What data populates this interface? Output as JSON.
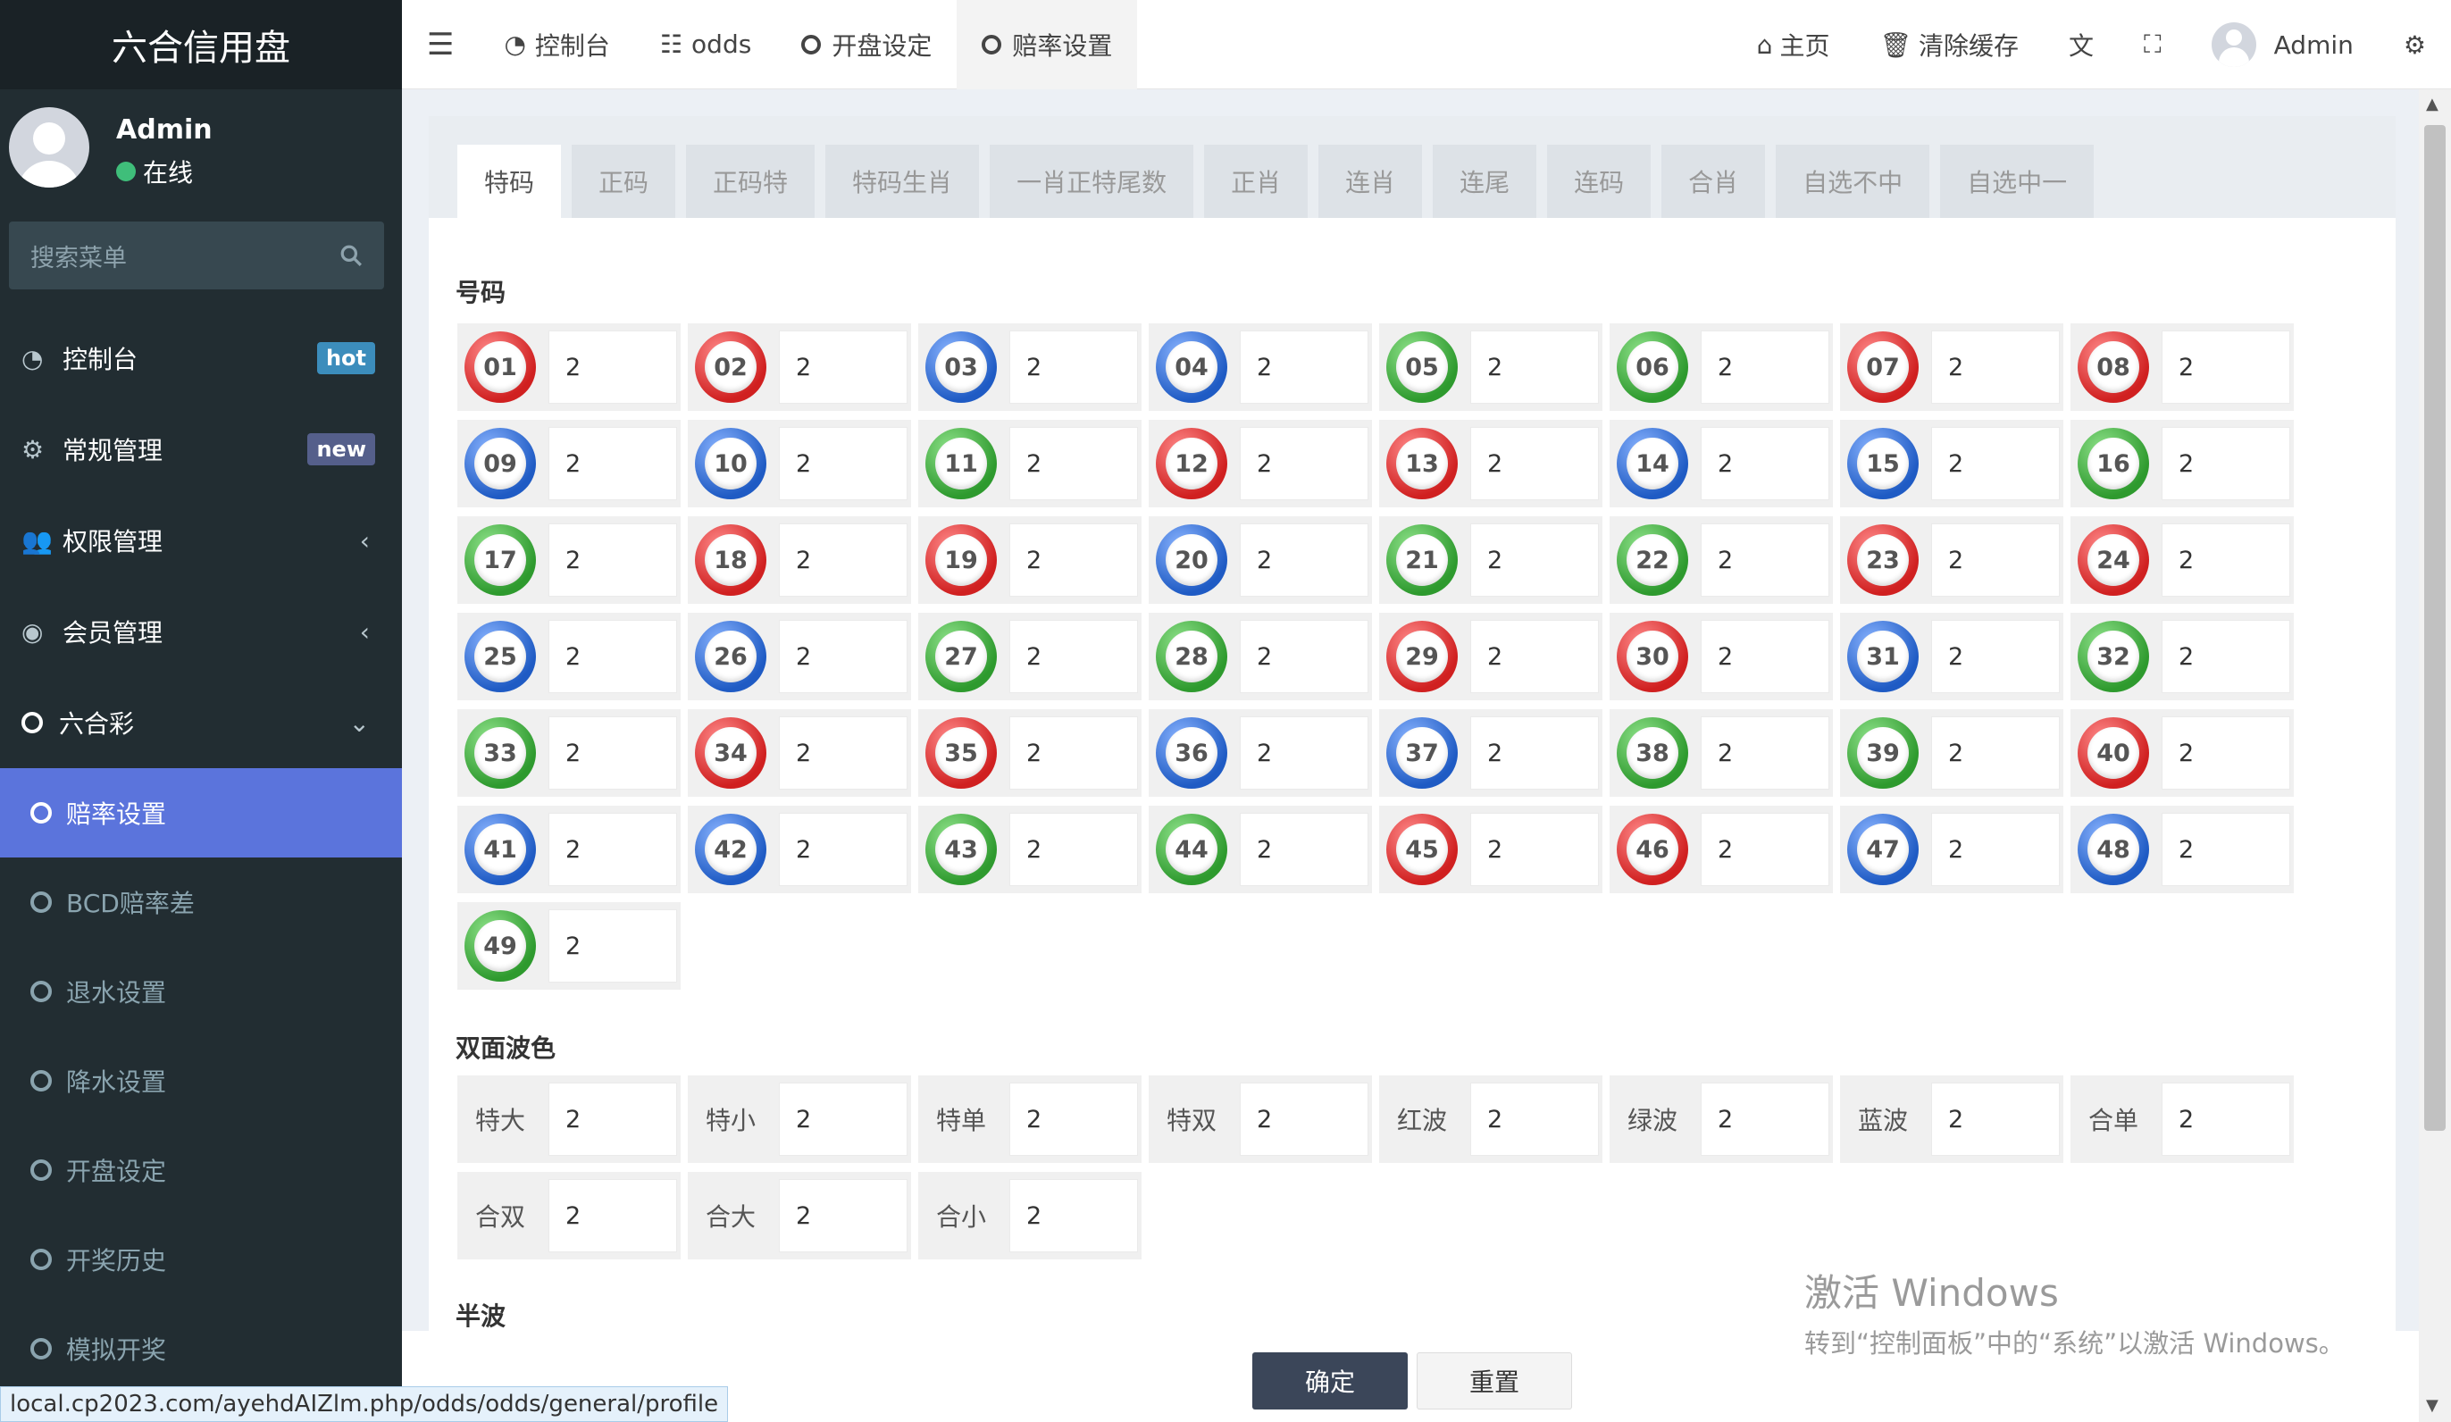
{
  "sidebar": {
    "brand": "六合信用盘",
    "user": {
      "name": "Admin",
      "status": "在线"
    },
    "search_placeholder": "搜索菜单",
    "menu": [
      {
        "icon": "dashboard-icon",
        "label": "控制台",
        "badge": "hot"
      },
      {
        "icon": "gears-icon",
        "label": "常规管理",
        "badge": "new"
      },
      {
        "icon": "users-icon",
        "label": "权限管理"
      },
      {
        "icon": "user-circle-icon",
        "label": "会员管理"
      },
      {
        "icon": "circle-icon",
        "label": "六合彩"
      }
    ],
    "submenu": [
      {
        "label": "赔率设置",
        "active": true
      },
      {
        "label": "BCD赔率差"
      },
      {
        "label": "退水设置"
      },
      {
        "label": "降水设置"
      },
      {
        "label": "开盘设定"
      },
      {
        "label": "开奖历史"
      },
      {
        "label": "模拟开奖"
      }
    ]
  },
  "topbar": {
    "tabs": [
      "控制台",
      "odds",
      "开盘设定",
      "赔率设置"
    ],
    "home": "主页",
    "clear_cache": "清除缓存",
    "admin": "Admin"
  },
  "tabs": [
    "特码",
    "正码",
    "正码特",
    "特码生肖",
    "一肖正特尾数",
    "正肖",
    "连肖",
    "连尾",
    "连码",
    "合肖",
    "自选不中",
    "自选中一"
  ],
  "sections": {
    "numbers_title": "号码",
    "two_sided_title": "双面波色",
    "half_wave_title": "半波"
  },
  "balls": [
    {
      "n": "01",
      "c": "red",
      "v": "2"
    },
    {
      "n": "02",
      "c": "red",
      "v": "2"
    },
    {
      "n": "03",
      "c": "blue",
      "v": "2"
    },
    {
      "n": "04",
      "c": "blue",
      "v": "2"
    },
    {
      "n": "05",
      "c": "green",
      "v": "2"
    },
    {
      "n": "06",
      "c": "green",
      "v": "2"
    },
    {
      "n": "07",
      "c": "red",
      "v": "2"
    },
    {
      "n": "08",
      "c": "red",
      "v": "2"
    },
    {
      "n": "09",
      "c": "blue",
      "v": "2"
    },
    {
      "n": "10",
      "c": "blue",
      "v": "2"
    },
    {
      "n": "11",
      "c": "green",
      "v": "2"
    },
    {
      "n": "12",
      "c": "red",
      "v": "2"
    },
    {
      "n": "13",
      "c": "red",
      "v": "2"
    },
    {
      "n": "14",
      "c": "blue",
      "v": "2"
    },
    {
      "n": "15",
      "c": "blue",
      "v": "2"
    },
    {
      "n": "16",
      "c": "green",
      "v": "2"
    },
    {
      "n": "17",
      "c": "green",
      "v": "2"
    },
    {
      "n": "18",
      "c": "red",
      "v": "2"
    },
    {
      "n": "19",
      "c": "red",
      "v": "2"
    },
    {
      "n": "20",
      "c": "blue",
      "v": "2"
    },
    {
      "n": "21",
      "c": "green",
      "v": "2"
    },
    {
      "n": "22",
      "c": "green",
      "v": "2"
    },
    {
      "n": "23",
      "c": "red",
      "v": "2"
    },
    {
      "n": "24",
      "c": "red",
      "v": "2"
    },
    {
      "n": "25",
      "c": "blue",
      "v": "2"
    },
    {
      "n": "26",
      "c": "blue",
      "v": "2"
    },
    {
      "n": "27",
      "c": "green",
      "v": "2"
    },
    {
      "n": "28",
      "c": "green",
      "v": "2"
    },
    {
      "n": "29",
      "c": "red",
      "v": "2"
    },
    {
      "n": "30",
      "c": "red",
      "v": "2"
    },
    {
      "n": "31",
      "c": "blue",
      "v": "2"
    },
    {
      "n": "32",
      "c": "green",
      "v": "2"
    },
    {
      "n": "33",
      "c": "green",
      "v": "2"
    },
    {
      "n": "34",
      "c": "red",
      "v": "2"
    },
    {
      "n": "35",
      "c": "red",
      "v": "2"
    },
    {
      "n": "36",
      "c": "blue",
      "v": "2"
    },
    {
      "n": "37",
      "c": "blue",
      "v": "2"
    },
    {
      "n": "38",
      "c": "green",
      "v": "2"
    },
    {
      "n": "39",
      "c": "green",
      "v": "2"
    },
    {
      "n": "40",
      "c": "red",
      "v": "2"
    },
    {
      "n": "41",
      "c": "blue",
      "v": "2"
    },
    {
      "n": "42",
      "c": "blue",
      "v": "2"
    },
    {
      "n": "43",
      "c": "green",
      "v": "2"
    },
    {
      "n": "44",
      "c": "green",
      "v": "2"
    },
    {
      "n": "45",
      "c": "red",
      "v": "2"
    },
    {
      "n": "46",
      "c": "red",
      "v": "2"
    },
    {
      "n": "47",
      "c": "blue",
      "v": "2"
    },
    {
      "n": "48",
      "c": "blue",
      "v": "2"
    },
    {
      "n": "49",
      "c": "green",
      "v": "2"
    }
  ],
  "two_sided": [
    {
      "label": "特大",
      "v": "2"
    },
    {
      "label": "特小",
      "v": "2"
    },
    {
      "label": "特单",
      "v": "2"
    },
    {
      "label": "特双",
      "v": "2"
    },
    {
      "label": "红波",
      "v": "2"
    },
    {
      "label": "绿波",
      "v": "2"
    },
    {
      "label": "蓝波",
      "v": "2"
    },
    {
      "label": "合单",
      "v": "2"
    },
    {
      "label": "合双",
      "v": "2"
    },
    {
      "label": "合大",
      "v": "2"
    },
    {
      "label": "合小",
      "v": "2"
    }
  ],
  "buttons": {
    "confirm": "确定",
    "reset": "重置"
  },
  "status_url": "local.cp2023.com/ayehdAIZlm.php/odds/odds/general/profile",
  "watermark": {
    "title": "激活 Windows",
    "sub": "转到“控制面板”中的“系统”以激活 Windows。"
  },
  "colors": {
    "sidebar": "#222d32",
    "active": "#5b74dc",
    "red": "#d02020",
    "blue": "#1f5bc4",
    "green": "#2e9a2e"
  }
}
